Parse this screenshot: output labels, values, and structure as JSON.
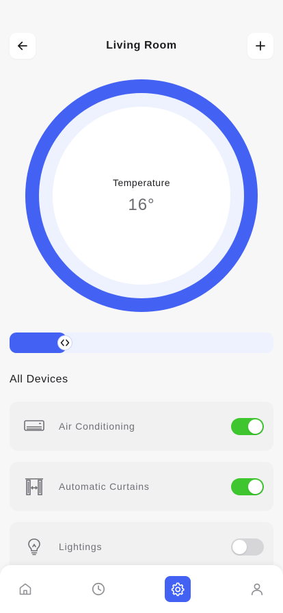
{
  "header": {
    "title": "Living Room",
    "back_icon": "arrow-left-icon",
    "add_icon": "plus-icon"
  },
  "dial": {
    "label": "Temperature",
    "value": "16°"
  },
  "slider": {
    "level": 0.21,
    "handle_icon": "chevrons-left-right-icon"
  },
  "devices_section": {
    "title": "All Devices"
  },
  "devices": [
    {
      "name": "Air Conditioning",
      "icon": "air-conditioner-icon",
      "on": true
    },
    {
      "name": "Automatic Curtains",
      "icon": "curtains-icon",
      "on": true
    },
    {
      "name": "Lightings",
      "icon": "lightbulb-icon",
      "on": false
    }
  ],
  "nav": {
    "items": [
      {
        "icon": "home-icon",
        "active": false
      },
      {
        "icon": "clock-icon",
        "active": false
      },
      {
        "icon": "gear-icon",
        "active": true
      },
      {
        "icon": "user-icon",
        "active": false
      }
    ]
  },
  "colors": {
    "accent": "#4361f3",
    "accent_light": "#eef2fe",
    "toggle_on": "#3fc62f",
    "toggle_off": "#d6d6d8",
    "icon_gray": "#8e8e93"
  }
}
